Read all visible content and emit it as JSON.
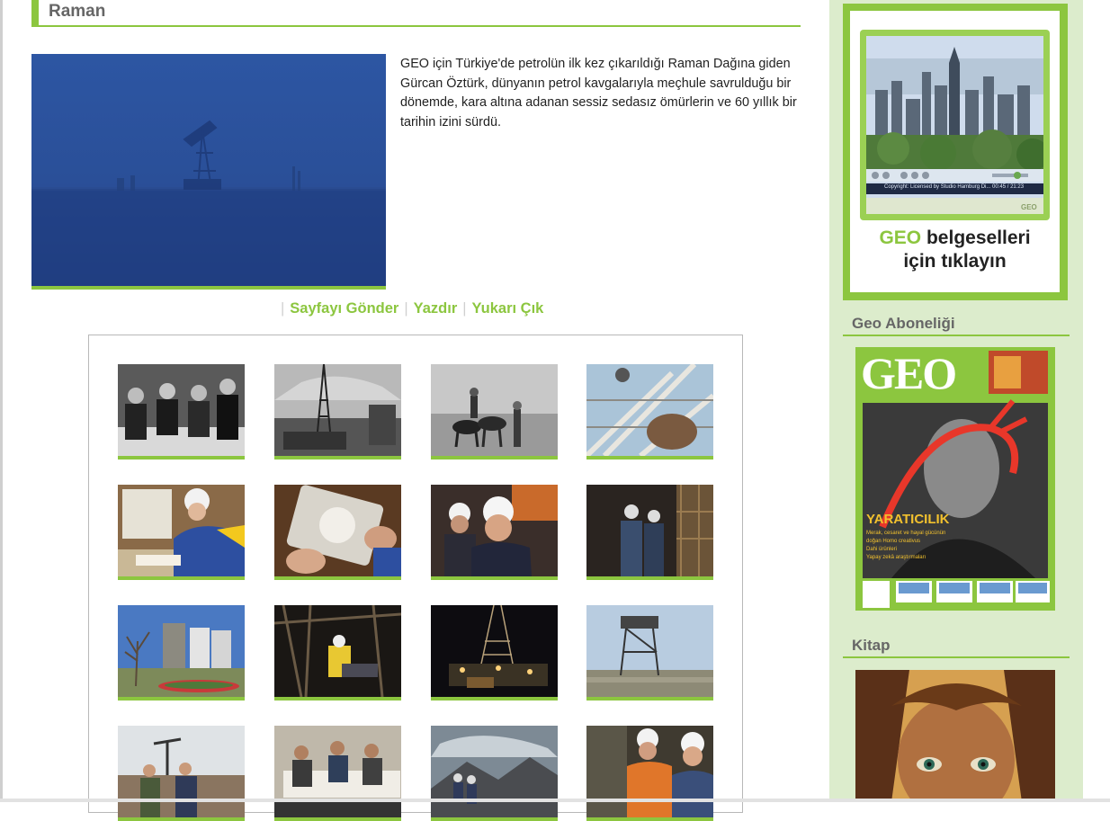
{
  "article": {
    "title": "Raman",
    "intro": "GEO için Türkiye'de petrolün ilk kez çıkarıldığı Raman Dağına giden Gürcan Öztürk, dünyanın petrol kavgalarıyla meçhule savrulduğu bir dönemde, kara altına adanan sessiz sedasız ömürlerin ve 60 yıllık bir tarihin izini sürdü."
  },
  "toolbar": {
    "separator": "|",
    "send_label": "Sayfayı Gönder",
    "print_label": "Yazdır",
    "top_label": "Yukarı Çık"
  },
  "gallery": {
    "thumbnail_count": 16
  },
  "sidebar": {
    "promo": {
      "brand": "GEO",
      "line1": "belgeselleri",
      "line2": "için tıklayın",
      "player_caption": "Copyright: Licensed by Studio Hamburg Di...  00:45 / 21:23",
      "player_watermark": "GEO"
    },
    "subscription_title": "Geo Aboneliği",
    "magazine": {
      "logo": "GEO",
      "cover_line": "YARATICILIK",
      "cover_bullets": [
        "Merak, cesaret ve hayal gücünün",
        "doğan Homo creativus",
        "Dahi ürünleri",
        "Yapay zekâ araştırmaları"
      ]
    },
    "book_title": "Kitap"
  },
  "colors": {
    "accent": "#8cc63f",
    "sidebar_bg": "#dceccc",
    "header_text": "#666666"
  }
}
